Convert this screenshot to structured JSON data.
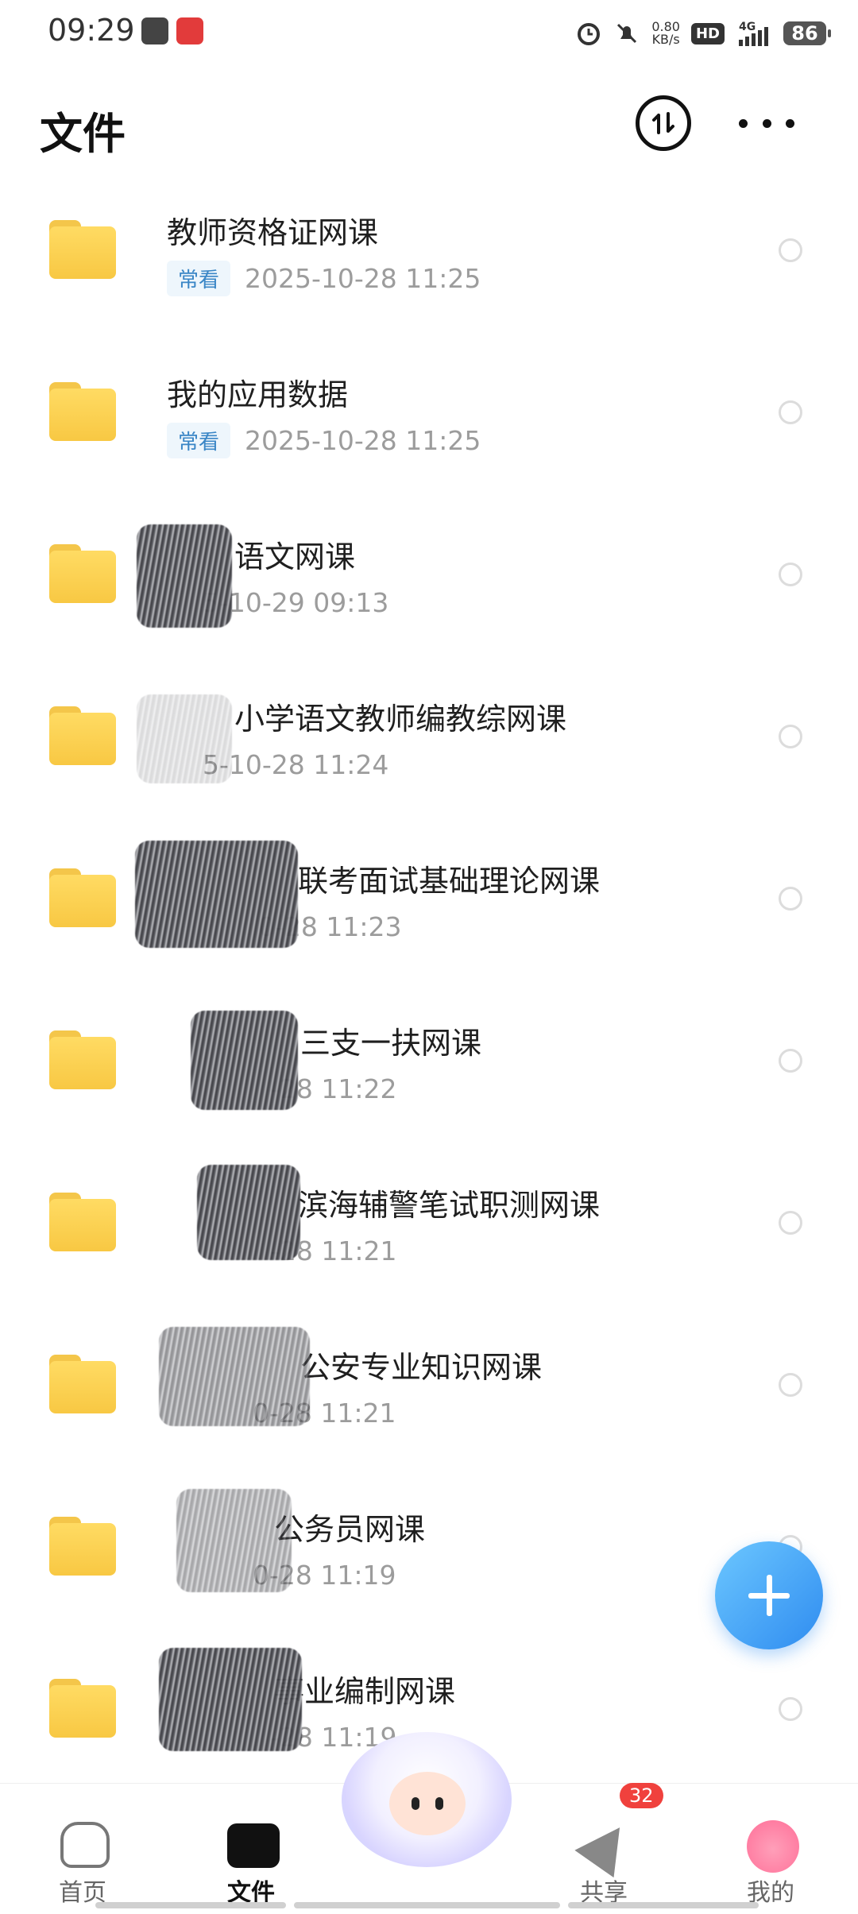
{
  "status_bar": {
    "time": "09:29",
    "net_speed_value": "0.80",
    "net_speed_unit": "KB/s",
    "hd": "HD",
    "network": "4G",
    "battery": "86",
    "icons": [
      "alarm-icon",
      "mute-icon",
      "signal-icon"
    ]
  },
  "header": {
    "title": "文件",
    "sort_icon": "sort-icon",
    "more_icon": "more-icon"
  },
  "files": [
    {
      "name": "教师资格证网课",
      "tag": "常看",
      "date": "2025-10-28  11:25"
    },
    {
      "name": "我的应用数据",
      "tag": "常看",
      "date": "2025-10-28  11:25"
    },
    {
      "name": "语文网课",
      "tag": "",
      "date": "5-10-29  09:13"
    },
    {
      "name": "小学语文教师编教综网课",
      "tag": "",
      "date": "5-10-28  11:24"
    },
    {
      "name": "联考面试基础理论网课",
      "tag": "",
      "date": "0-28  11:23"
    },
    {
      "name": "三支一扶网课",
      "tag": "",
      "date": "-28  11:22"
    },
    {
      "name": "滨海辅警笔试职测网课",
      "tag": "",
      "date": "-28  11:21"
    },
    {
      "name": "公安专业知识网课",
      "tag": "",
      "date": "0-28  11:21"
    },
    {
      "name": "公务员网课",
      "tag": "",
      "date": "0-28  11:19"
    },
    {
      "name": "事业编制网课",
      "tag": "",
      "date": "-28  11:19"
    }
  ],
  "fab": {
    "icon": "plus-icon"
  },
  "tabbar": {
    "home": "首页",
    "files": "文件",
    "share": "共享",
    "share_badge": "32",
    "me": "我的"
  }
}
